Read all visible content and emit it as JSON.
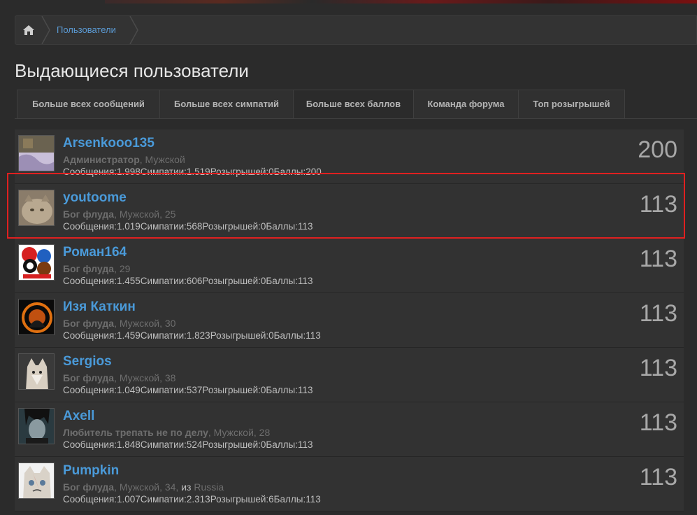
{
  "breadcrumb": {
    "home_icon": "home-icon",
    "link_label": "Пользователи"
  },
  "page": {
    "title": "Выдающиеся пользователи"
  },
  "tabs": [
    {
      "label": "Больше всех сообщений",
      "active": false
    },
    {
      "label": "Больше всех симпатий",
      "active": false
    },
    {
      "label": "Больше всех баллов",
      "active": true
    },
    {
      "label": "Команда форума",
      "active": false
    },
    {
      "label": "Топ розыгрышей",
      "active": false
    }
  ],
  "members": [
    {
      "name": "Arsenkooo135",
      "user_title": "Администратор",
      "details": ", Мужской",
      "from_word": "",
      "location": "",
      "stats": "Сообщения:1.998Симпатии:1.519Розыгрышей:0Баллы:200",
      "score": "200",
      "avatar": "avatar-purple-fabric"
    },
    {
      "name": "youtoome",
      "user_title": "Бог флуда",
      "details": ", Мужской, 25",
      "from_word": "",
      "location": "",
      "stats": "Сообщения:1.019Симпатии:568Розыгрышей:0Баллы:113",
      "score": "113",
      "avatar": "avatar-cat"
    },
    {
      "name": "Роман164",
      "user_title": "Бог флуда",
      "details": ", 29",
      "from_word": "",
      "location": "",
      "stats": "Сообщения:1.455Симпатии:606Розыгрышей:0Баллы:113",
      "score": "113",
      "avatar": "avatar-cartoon"
    },
    {
      "name": "Изя Каткин",
      "user_title": "Бог флуда",
      "details": ", Мужской, 30",
      "from_word": "",
      "location": "",
      "stats": "Сообщения:1.459Симпатии:1.823Розыгрышей:0Баллы:113",
      "score": "113",
      "avatar": "avatar-dark-fire"
    },
    {
      "name": "Sergios",
      "user_title": "Бог флуда",
      "details": ", Мужской, 38",
      "from_word": "",
      "location": "",
      "stats": "Сообщения:1.049Симпатии:537Розыгрышей:0Баллы:113",
      "score": "113",
      "avatar": "avatar-husky"
    },
    {
      "name": "Axell",
      "user_title": "Любитель трепать не по делу",
      "details": ", Мужской, 28",
      "from_word": "",
      "location": "",
      "stats": "Сообщения:1.848Симпатии:524Розыгрышей:0Баллы:113",
      "score": "113",
      "avatar": "avatar-dark-figure"
    },
    {
      "name": "Pumpkin",
      "user_title": "Бог флуда",
      "details": ", Мужской, 34, ",
      "from_word": "из",
      "location": " Russia",
      "stats": "Сообщения:1.007Симпатии:2.313Розыгрышей:6Баллы:113",
      "score": "113",
      "avatar": "avatar-grumpy-cat"
    }
  ]
}
